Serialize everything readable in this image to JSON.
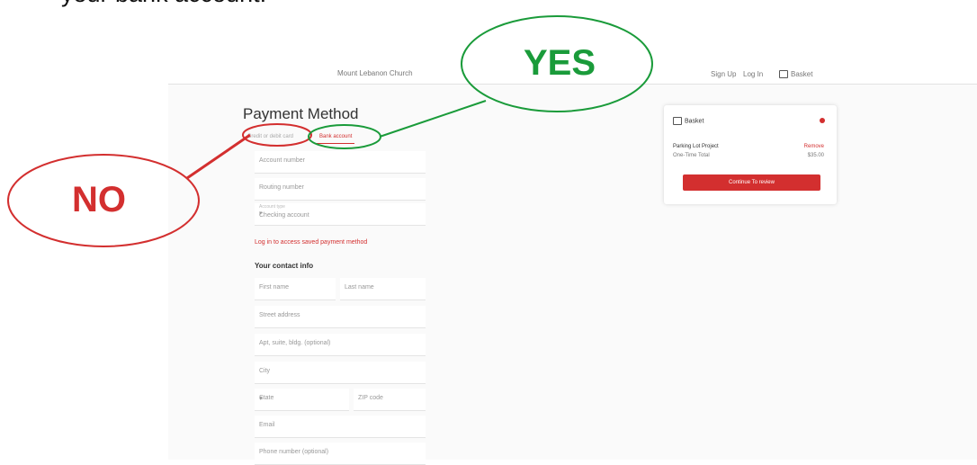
{
  "caption": "your bank account.",
  "nav": {
    "org": "Mount Lebanon Church",
    "sign_up": "Sign Up",
    "log_in": "Log In",
    "basket": "Basket"
  },
  "payment": {
    "title": "Payment Method",
    "tabs": [
      "Credit or debit card",
      "Bank account"
    ],
    "fields": {
      "account_number": "Account number",
      "routing_number": "Routing number",
      "account_type_label": "Account type",
      "account_type_value": "Checking account"
    },
    "login_link": "Log in to access saved payment method",
    "contact_title": "Your contact info",
    "contact": {
      "first_name": "First name",
      "last_name": "Last name",
      "street": "Street address",
      "apt": "Apt, suite, bldg. (optional)",
      "city": "City",
      "state": "State",
      "zip": "ZIP code",
      "email": "Email",
      "phone": "Phone number (optional)"
    }
  },
  "basket": {
    "title": "Basket",
    "item_name": "Parking Lot Project",
    "remove": "Remove",
    "total_label": "One-Time Total",
    "total_value": "$35.00",
    "continue": "Continue To review"
  },
  "annotations": {
    "no": "NO",
    "yes": "YES",
    "no_color": "#d32f2f",
    "yes_color": "#1a9b3a"
  }
}
